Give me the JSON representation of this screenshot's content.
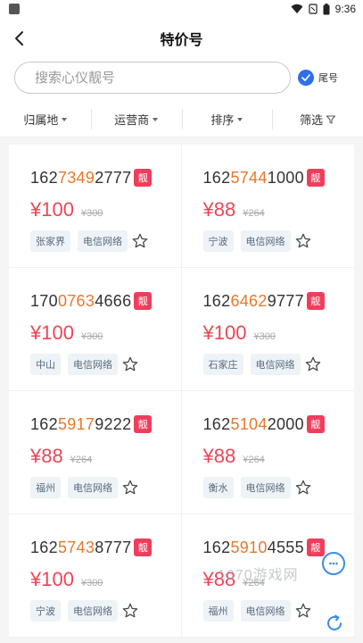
{
  "status": {
    "time": "9:36"
  },
  "header": {
    "title": "特价号"
  },
  "search": {
    "placeholder": "搜索心仪靓号",
    "tail_label": "尾号"
  },
  "filters": [
    {
      "label": "归属地"
    },
    {
      "label": "运营商"
    },
    {
      "label": "排序"
    },
    {
      "label": "筛选"
    }
  ],
  "badge_label": "靓",
  "cards": [
    {
      "prefix": "162",
      "highlight": "7349",
      "suffix": "2777",
      "price": "¥100",
      "original": "¥300",
      "city": "张家界",
      "network": "电信网络"
    },
    {
      "prefix": "162",
      "highlight": "5744",
      "suffix": "1000",
      "price": "¥88",
      "original": "¥264",
      "city": "宁波",
      "network": "电信网络"
    },
    {
      "prefix": "170",
      "highlight": "0763",
      "suffix": "4666",
      "price": "¥100",
      "original": "¥300",
      "city": "中山",
      "network": "电信网络"
    },
    {
      "prefix": "162",
      "highlight": "6462",
      "suffix": "9777",
      "price": "¥100",
      "original": "¥300",
      "city": "石家庄",
      "network": "电信网络"
    },
    {
      "prefix": "162",
      "highlight": "5917",
      "suffix": "9222",
      "price": "¥88",
      "original": "¥264",
      "city": "福州",
      "network": "电信网络"
    },
    {
      "prefix": "162",
      "highlight": "5104",
      "suffix": "2000",
      "price": "¥88",
      "original": "¥264",
      "city": "衡水",
      "network": "电信网络"
    },
    {
      "prefix": "162",
      "highlight": "5743",
      "suffix": "8777",
      "price": "¥100",
      "original": "¥300",
      "city": "宁波",
      "network": "电信网络"
    },
    {
      "prefix": "162",
      "highlight": "5910",
      "suffix": "4555",
      "price": "¥88",
      "original": "¥264",
      "city": "福州",
      "network": "电信网络"
    }
  ],
  "watermark": "1070游戏网",
  "colors": {
    "accent_blue": "#2f6fe8",
    "price_red": "#ee4456",
    "highlight_orange": "#e8782a",
    "badge_red": "#ef3e5c",
    "tag_bg": "#eef3f8"
  },
  "icons": [
    "back-arrow-icon",
    "check-icon",
    "caret-down-icon",
    "funnel-icon",
    "star-icon",
    "chat-icon",
    "refresh-icon",
    "wifi-icon",
    "sim-icon",
    "battery-icon"
  ]
}
